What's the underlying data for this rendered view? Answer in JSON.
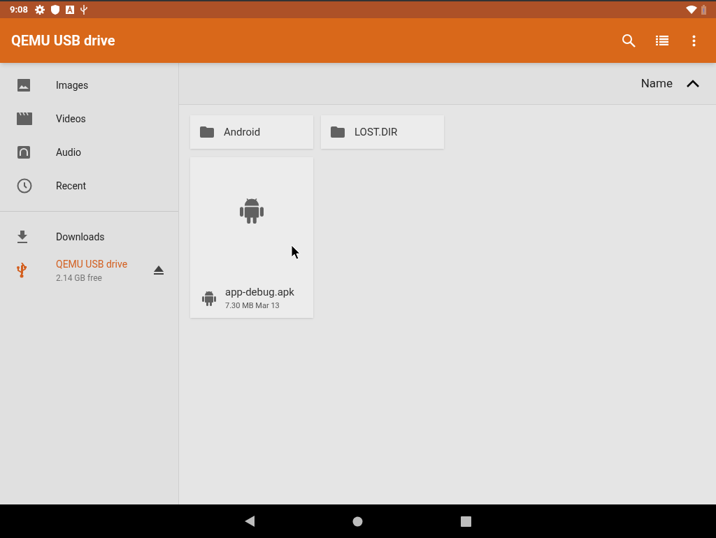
{
  "status_bar": {
    "time": "9:08"
  },
  "toolbar": {
    "title": "QEMU USB drive"
  },
  "sidebar": {
    "groups": [
      [
        {
          "kind": "images",
          "label": "Images",
          "selected": false
        },
        {
          "kind": "videos",
          "label": "Videos",
          "selected": false
        },
        {
          "kind": "audio",
          "label": "Audio",
          "selected": false
        },
        {
          "kind": "recent",
          "label": "Recent",
          "selected": false
        }
      ],
      [
        {
          "kind": "downloads",
          "label": "Downloads",
          "selected": false
        },
        {
          "kind": "usb",
          "label": "QEMU USB drive",
          "subtitle": "2.14 GB free",
          "selected": true
        }
      ]
    ]
  },
  "sort_header": {
    "label": "Name"
  },
  "folders": [
    {
      "name": "Android"
    },
    {
      "name": "LOST.DIR"
    }
  ],
  "files": [
    {
      "name": "app-debug.apk",
      "meta": "7.30 MB Mar 13"
    }
  ]
}
